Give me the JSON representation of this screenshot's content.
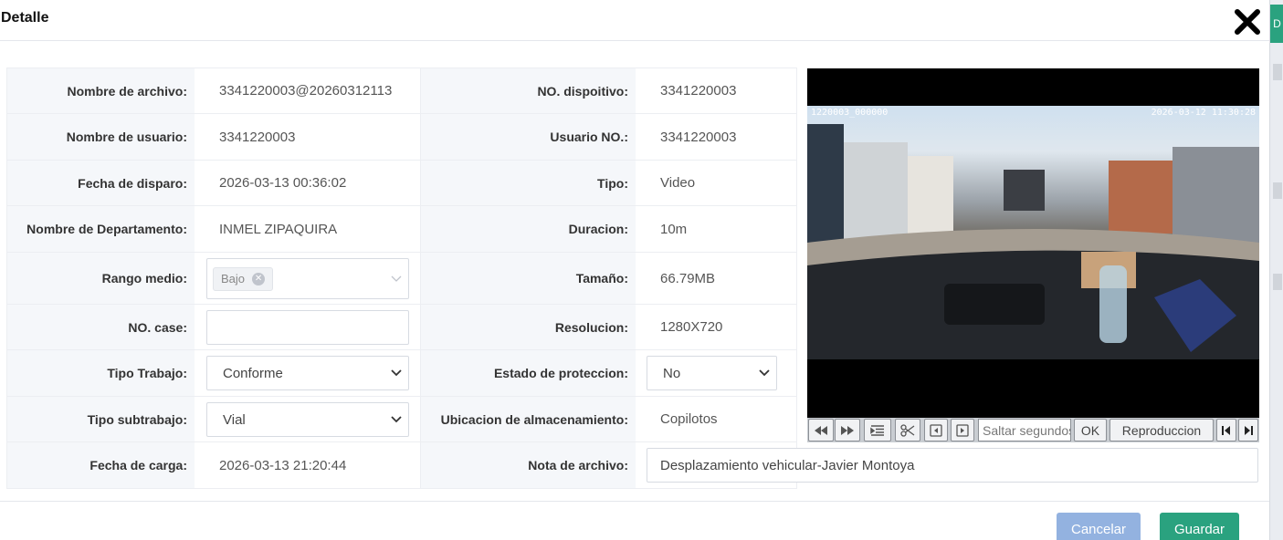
{
  "dialog": {
    "title": "Detalle"
  },
  "fields": {
    "nombre_archivo": {
      "label": "Nombre de archivo",
      "value": "3341220003@20260312113"
    },
    "no_dispositivo": {
      "label": "NO. dispoitivo",
      "value": "3341220003"
    },
    "nombre_usuario": {
      "label": "Nombre de usuario",
      "value": "3341220003"
    },
    "usuario_no": {
      "label": "Usuario NO.",
      "value": "3341220003"
    },
    "fecha_disparo": {
      "label": "Fecha de disparo",
      "value": "2026-03-13 00:36:02"
    },
    "tipo": {
      "label": "Tipo",
      "value": "Video"
    },
    "departamento": {
      "label": "Nombre de Departamento",
      "value": "INMEL ZIPAQUIRA"
    },
    "duracion": {
      "label": "Duracion",
      "value": "10m"
    },
    "rango_medio": {
      "label": "Rango medio",
      "tag": "Bajo"
    },
    "tamano": {
      "label": "Tamaño",
      "value": "66.79MB"
    },
    "no_case": {
      "label": "NO. case",
      "value": ""
    },
    "resolucion": {
      "label": "Resolucion",
      "value": "1280X720"
    },
    "tipo_trabajo": {
      "label": "Tipo Trabajo",
      "value": "Conforme"
    },
    "estado_proteccion": {
      "label": "Estado de proteccion",
      "value": "No"
    },
    "tipo_subtrabajo": {
      "label": "Tipo subtrabajo",
      "value": "Vial"
    },
    "ubicacion": {
      "label": "Ubicacion de almacenamiento",
      "value": "Copilotos"
    },
    "fecha_carga": {
      "label": "Fecha de carga",
      "value": "2026-03-13 21:20:44"
    },
    "nota_archivo": {
      "label": "Nota de archivo",
      "value": "Desplazamiento vehicular-Javier Montoya"
    }
  },
  "player": {
    "osd_left": "1220003_000000",
    "osd_right": "2026-03-12 11:30:28",
    "jump_placeholder": "Saltar segundos",
    "ok_label": "OK",
    "play_label": "Reproduccion"
  },
  "footer": {
    "cancel_label": "Cancelar",
    "save_label": "Guardar"
  },
  "side": {
    "tab_letter": "D"
  },
  "colors": {
    "primary": "#2aa27f",
    "cancel": "#93b2e0",
    "label_bg": "#f5f7fa"
  }
}
